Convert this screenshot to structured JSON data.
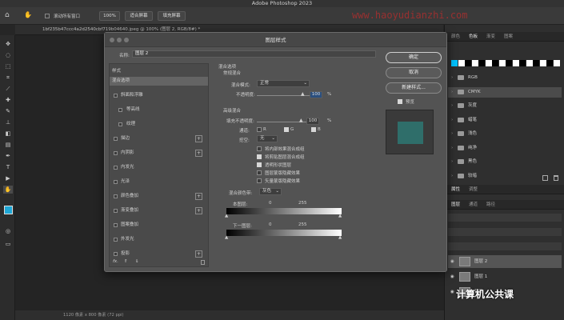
{
  "app": {
    "title": "Adobe Photoshop 2023",
    "watermark": "www.haoyudianzhi.com",
    "options_bar": {
      "scroll_all_windows": "滚动所有窗口",
      "zoom_pct": "100%",
      "fit_screen": "适合屏幕",
      "fill_screen": "填充屏幕"
    },
    "doc_tab": "1bf235b47ccc4a2d2540cbf719b04640.jpeg @ 100% (图层 2, RGB/8#) *",
    "status": "1120 像素 x 800 像素 (72 ppi)"
  },
  "right_panel": {
    "tabs": [
      "颜色",
      "色板",
      "渐变",
      "图案"
    ],
    "active_tab": "色板",
    "swatches": [
      "#00c2ff",
      "#ffffff",
      "#000000",
      "#ffffff",
      "#000000",
      "#ffffff",
      "#000000",
      "#ffffff",
      "#000000",
      "#ffffff",
      "#000000",
      "#ffffff",
      "#000000",
      "#ffffff",
      "#000000",
      "#ffffff"
    ],
    "folders": [
      "RGB",
      "CMYK",
      "灰度",
      "蜡笔",
      "浅色",
      "纯净",
      "黑色",
      "较暗"
    ],
    "selected_folder": "CMYK",
    "props_tabs": [
      "属性",
      "调整"
    ],
    "layers_tabs": [
      "图层",
      "通道",
      "路径"
    ],
    "layers": [
      {
        "name": "图层 2",
        "selected": true
      },
      {
        "name": "图层 1",
        "selected": false
      },
      {
        "name": "背景",
        "selected": false
      }
    ],
    "brand": "计算机公共课"
  },
  "dialog": {
    "title": "图层样式",
    "name_label": "名称:",
    "name_value": "图层 2",
    "styles_header": "样式",
    "styles": [
      {
        "label": "混合选项",
        "check": false,
        "plus": false,
        "indent": false,
        "selected": true
      },
      {
        "label": "斜面和浮雕",
        "check": true,
        "plus": false,
        "indent": false,
        "selected": false
      },
      {
        "label": "等高线",
        "check": true,
        "plus": false,
        "indent": true,
        "selected": false
      },
      {
        "label": "纹理",
        "check": true,
        "plus": false,
        "indent": true,
        "selected": false
      },
      {
        "label": "描边",
        "check": true,
        "plus": true,
        "indent": false,
        "selected": false
      },
      {
        "label": "内阴影",
        "check": true,
        "plus": true,
        "indent": false,
        "selected": false
      },
      {
        "label": "内发光",
        "check": true,
        "plus": false,
        "indent": false,
        "selected": false
      },
      {
        "label": "光泽",
        "check": true,
        "plus": false,
        "indent": false,
        "selected": false
      },
      {
        "label": "颜色叠加",
        "check": true,
        "plus": true,
        "indent": false,
        "selected": false
      },
      {
        "label": "渐变叠加",
        "check": true,
        "plus": true,
        "indent": false,
        "selected": false
      },
      {
        "label": "图案叠加",
        "check": true,
        "plus": false,
        "indent": false,
        "selected": false
      },
      {
        "label": "外发光",
        "check": true,
        "plus": false,
        "indent": false,
        "selected": false
      },
      {
        "label": "投影",
        "check": true,
        "plus": true,
        "indent": false,
        "selected": false
      }
    ],
    "fx_label": "fx.",
    "blend_options": "混合选项",
    "general_blending": "常规混合",
    "blend_mode_label": "混合模式:",
    "blend_mode_value": "正常",
    "opacity_label": "不透明度:",
    "opacity_value": "100",
    "pct": "%",
    "advanced_blending": "高级混合",
    "fill_opacity_label": "填充不透明度:",
    "fill_opacity_value": "100",
    "channels_label": "通道:",
    "channel_r": "R",
    "channel_g": "G",
    "channel_b": "B",
    "knockout_label": "挖空:",
    "knockout_value": "无",
    "options": [
      {
        "label": "将内部效果混合成组",
        "checked": false
      },
      {
        "label": "将剪贴图层混合成组",
        "checked": true
      },
      {
        "label": "透明形状图层",
        "checked": true
      },
      {
        "label": "图层蒙版隐藏效果",
        "checked": false
      },
      {
        "label": "矢量蒙版隐藏效果",
        "checked": false
      }
    ],
    "blend_if_label": "混合颜色带:",
    "blend_if_value": "灰色",
    "this_layer_label": "本图层:",
    "underlying_label": "下一图层:",
    "range_min": "0",
    "range_max": "255",
    "buttons": {
      "ok": "确定",
      "cancel": "取消",
      "new_style": "新建样式...",
      "preview": "预览"
    },
    "preview_checked": true,
    "preview_color": "#2f6e6a"
  }
}
